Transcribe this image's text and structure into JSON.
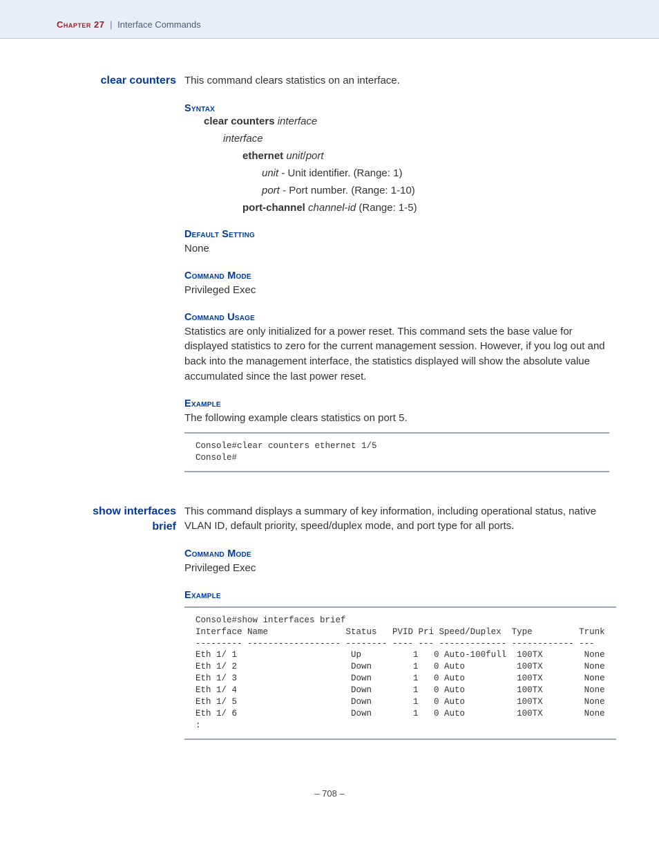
{
  "header": {
    "chapter_label": "Chapter 27",
    "pipe": "|",
    "section": "Interface Commands"
  },
  "cmd1": {
    "name": "clear counters",
    "desc": "This command clears statistics on an interface.",
    "syntax_head": "Syntax",
    "syntax_cmd_bold": "clear counters",
    "syntax_cmd_ital": "interface",
    "syntax_interface": "interface",
    "syntax_eth_bold": "ethernet",
    "syntax_eth_ital1": "unit",
    "syntax_eth_slash": "/",
    "syntax_eth_ital2": "port",
    "syntax_unit_ital": "unit",
    "syntax_unit_text": " - Unit identifier. (Range: 1)",
    "syntax_port_ital": "port",
    "syntax_port_text": " - Port number. (Range: 1-10)",
    "syntax_pc_bold": "port-channel",
    "syntax_pc_ital": "channel-id",
    "syntax_pc_text": " (Range: 1-5)",
    "default_head": "Default Setting",
    "default_body": "None",
    "mode_head": "Command Mode",
    "mode_body": "Privileged Exec",
    "usage_head": "Command Usage",
    "usage_body": "Statistics are only initialized for a power reset. This command sets the base value for displayed statistics to zero for the current management session. However, if you log out and back into the management interface, the statistics displayed will show the absolute value accumulated since the last power reset.",
    "example_head": "Example",
    "example_intro": "The following example clears statistics on port 5.",
    "example_code": "Console#clear counters ethernet 1/5\nConsole#"
  },
  "cmd2": {
    "name1": "show interfaces",
    "name2": "brief",
    "desc": "This command displays a summary of key information, including operational status, native VLAN ID, default priority, speed/duplex mode, and port type for all ports.",
    "mode_head": "Command Mode",
    "mode_body": "Privileged Exec",
    "example_head": "Example",
    "example_code": "Console#show interfaces brief\nInterface Name               Status   PVID Pri Speed/Duplex  Type         Trunk\n--------- ------------------ -------- ---- --- ------------- ------------ ---\nEth 1/ 1                      Up          1   0 Auto-100full  100TX        None\nEth 1/ 2                      Down        1   0 Auto          100TX        None\nEth 1/ 3                      Down        1   0 Auto          100TX        None\nEth 1/ 4                      Down        1   0 Auto          100TX        None\nEth 1/ 5                      Down        1   0 Auto          100TX        None\nEth 1/ 6                      Down        1   0 Auto          100TX        None\n:"
  },
  "page_number": "–  708  –"
}
